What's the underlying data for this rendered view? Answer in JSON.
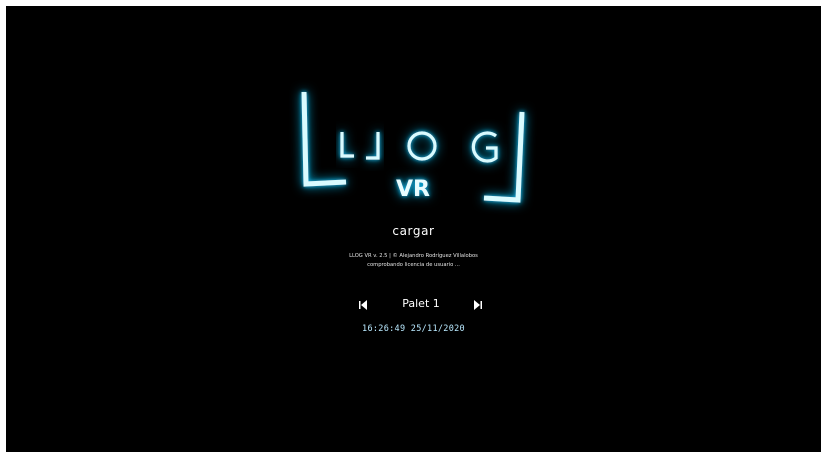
{
  "logo": {
    "letters": [
      "L",
      "L",
      "O",
      "G"
    ],
    "subtitle": "VR",
    "glow_color": "#19c8ff",
    "icon": "lloog-vr-neon-logo"
  },
  "menu": {
    "load_label": "cargar"
  },
  "info": {
    "version_line": "LLOG VR  v. 2.5 | © Alejandro Rodríguez Villalobos",
    "status_line": "comprobando licencia de usuario ..."
  },
  "palet": {
    "prev_icon": "triangle-left-icon",
    "label": "Palet 1",
    "next_icon": "triangle-right-icon"
  },
  "timestamp": "16:26:49 25/11/2020"
}
